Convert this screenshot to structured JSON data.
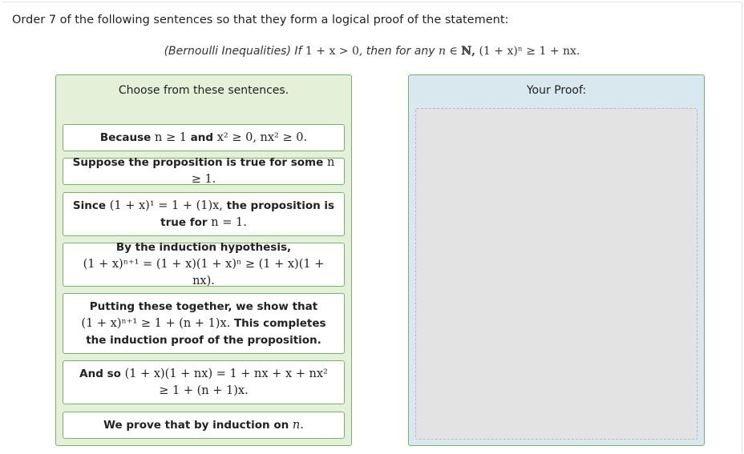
{
  "instruction": "Order 7 of the following sentences so that they form a logical proof of the statement:",
  "statement": {
    "label": "(Bernoulli Inequalities)",
    "if_word": "If",
    "condition": "1 + x > 0,",
    "then_text": "then for any",
    "n_var": "n",
    "in_symbol": "∈",
    "naturals": "ℕ,",
    "inequality": "(1 + x)ⁿ ≥ 1 + nx."
  },
  "choose_panel": {
    "title": "Choose from these sentences."
  },
  "proof_panel": {
    "title": "Your Proof:"
  },
  "sentences": [
    {
      "p1": "Because",
      "m1": "n ≥ 1",
      "p2": "and",
      "m2": "x² ≥ 0, nx² ≥ 0."
    },
    {
      "p1": "Suppose the proposition is true for some",
      "m1": "n ≥ 1."
    },
    {
      "p1": "Since",
      "m1": "(1 + x)¹ = 1 + (1)x,",
      "p2": "the proposition is true for",
      "m2": "n = 1."
    },
    {
      "p1": "By the induction hypothesis,",
      "m1": "(1 + x)ⁿ⁺¹ = (1 + x)(1 + x)ⁿ ≥ (1 + x)(1 + nx)."
    },
    {
      "p1": "Putting these together, we show that",
      "m1": "(1 + x)ⁿ⁺¹ ≥ 1 + (n + 1)x.",
      "p2": "This completes the induction proof of the proposition."
    },
    {
      "p1": "And so",
      "m1": "(1 + x)(1 + nx) = 1 + nx + x + nx²",
      "m2": "≥ 1 + (n + 1)x."
    },
    {
      "p1": "We prove that by induction on",
      "m1": "n."
    }
  ]
}
